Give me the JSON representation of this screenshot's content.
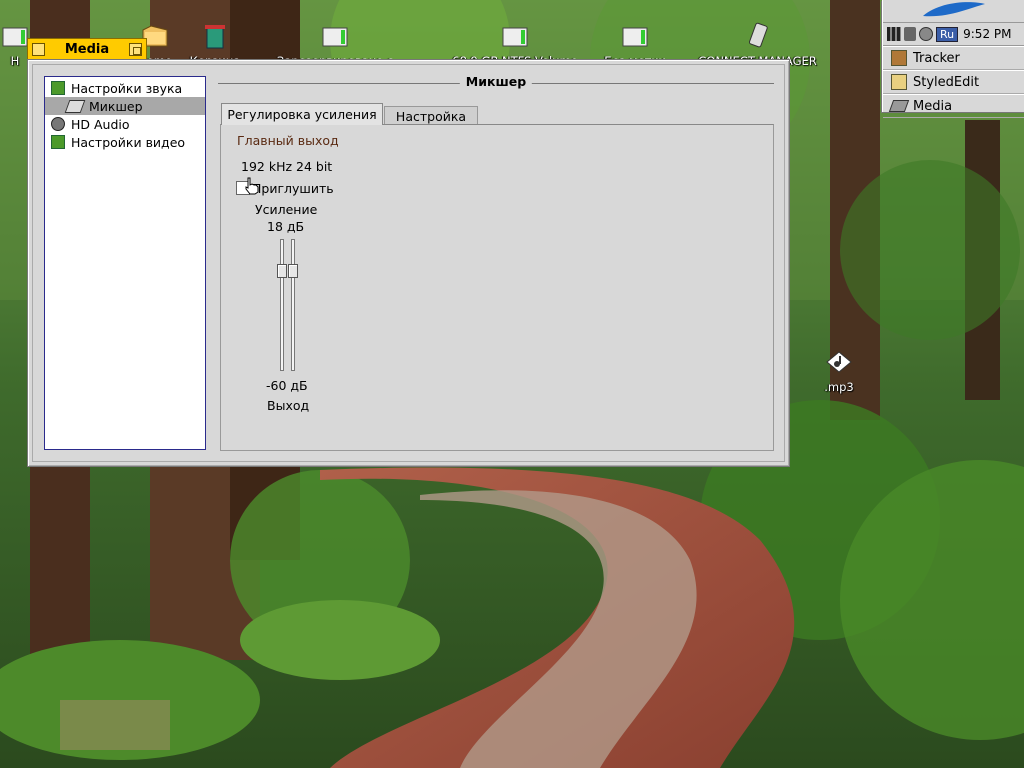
{
  "desktop": {
    "icons": [
      {
        "name": "home-volume",
        "label": "H"
      },
      {
        "name": "home-folder",
        "label": "Home"
      },
      {
        "name": "trash",
        "label": "Корзина"
      },
      {
        "name": "boot-volume",
        "label": "Зарезервировано с"
      },
      {
        "name": "ntfs-volume",
        "label": "68,9 GB NTFS Volume"
      },
      {
        "name": "disk-volume",
        "label": "Без метки"
      },
      {
        "name": "usb-volume",
        "label": "CONNECT MANAGER"
      },
      {
        "name": "mp3-file",
        "label": ".mp3"
      }
    ]
  },
  "deskbar": {
    "locale": "Ru",
    "clock": "9:52 PM",
    "apps": [
      {
        "label": "Tracker",
        "icon": "tracker-icon"
      },
      {
        "label": "StyledEdit",
        "icon": "styled-edit-icon"
      },
      {
        "label": "Media",
        "icon": "media-icon"
      }
    ]
  },
  "window": {
    "title": "Media",
    "sidebar": [
      {
        "label": "Настройки звука",
        "icon": "speaker-icon",
        "indent": 0,
        "selected": false
      },
      {
        "label": "Микшер",
        "icon": "mixer-icon",
        "indent": 1,
        "selected": true
      },
      {
        "label": "HD Audio",
        "icon": "audio-device-icon",
        "indent": 0,
        "selected": false
      },
      {
        "label": "Настройки видео",
        "icon": "video-icon",
        "indent": 0,
        "selected": false
      }
    ],
    "section_title": "Микшер",
    "tabs": [
      {
        "label": "Регулировка усиления",
        "active": true
      },
      {
        "label": "Настройка",
        "active": false
      }
    ],
    "channel": {
      "group_title": "Главный выход",
      "format": "192 kHz 24 bit",
      "mute_label": "Приглушить",
      "mute_checked": false,
      "gain_label": "Усиление",
      "max_label": "18 дБ",
      "min_label": "-60 дБ",
      "output_label": "Выход"
    }
  },
  "colors": {
    "window_tab": "#ffcb00",
    "panel_bg": "#d8d8d8",
    "selection": "#a8a8a8",
    "sidebar_border": "#2a2a8c",
    "locale_badge": "#3b5ea8"
  }
}
